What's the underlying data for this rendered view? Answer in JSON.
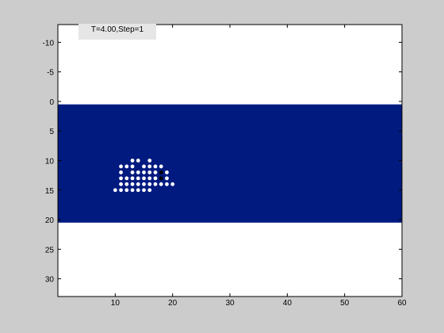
{
  "status_text": "T=4.00,Step=1",
  "colors": {
    "figure_bg": "#cccccc",
    "axes_bg": "#ffffff",
    "band": "#001a80",
    "particle": "#ffffff",
    "particle_alt": "#000000",
    "status_bg": "#e6e6e6"
  },
  "chart_data": {
    "type": "scatter",
    "title": "",
    "xlabel": "",
    "ylabel": "",
    "xlim": [
      0,
      60
    ],
    "ylim": [
      33,
      -13
    ],
    "y_reversed": true,
    "grid": false,
    "xticks": [
      10,
      20,
      30,
      40,
      50,
      60
    ],
    "xtick_labels": [
      "10",
      "20",
      "30",
      "40",
      "50",
      "60"
    ],
    "yticks": [
      -10,
      -5,
      0,
      5,
      10,
      15,
      20,
      25,
      30
    ],
    "ytick_labels": [
      "-10",
      "-5",
      "0",
      "5",
      "10",
      "15",
      "20",
      "25",
      "30"
    ],
    "band": {
      "y_from": 0.5,
      "y_to": 20.5
    },
    "series": [
      {
        "color": "white",
        "points": [
          [
            13,
            10
          ],
          [
            14,
            10
          ],
          [
            16,
            10
          ],
          [
            11,
            11
          ],
          [
            12,
            11
          ],
          [
            13,
            11
          ],
          [
            15,
            11
          ],
          [
            16,
            11
          ],
          [
            17,
            11
          ],
          [
            18,
            11
          ],
          [
            11,
            12
          ],
          [
            13,
            12
          ],
          [
            14,
            12
          ],
          [
            15,
            12
          ],
          [
            16,
            12
          ],
          [
            17,
            12
          ],
          [
            19,
            12
          ],
          [
            11,
            13
          ],
          [
            12,
            13
          ],
          [
            13,
            13
          ],
          [
            14,
            13
          ],
          [
            15,
            13
          ],
          [
            16,
            13
          ],
          [
            17,
            13
          ],
          [
            19,
            13
          ],
          [
            11,
            14
          ],
          [
            12,
            14
          ],
          [
            13,
            14
          ],
          [
            14,
            14
          ],
          [
            15,
            14
          ],
          [
            16,
            14
          ],
          [
            17,
            14
          ],
          [
            18,
            14
          ],
          [
            19,
            14
          ],
          [
            20,
            14
          ],
          [
            10,
            15
          ],
          [
            11,
            15
          ],
          [
            12,
            15
          ],
          [
            13,
            15
          ],
          [
            14,
            15
          ],
          [
            15,
            15
          ],
          [
            16,
            15
          ]
        ]
      },
      {
        "color": "black",
        "points": [
          [
            18,
            12
          ],
          [
            18,
            13
          ]
        ]
      }
    ]
  }
}
